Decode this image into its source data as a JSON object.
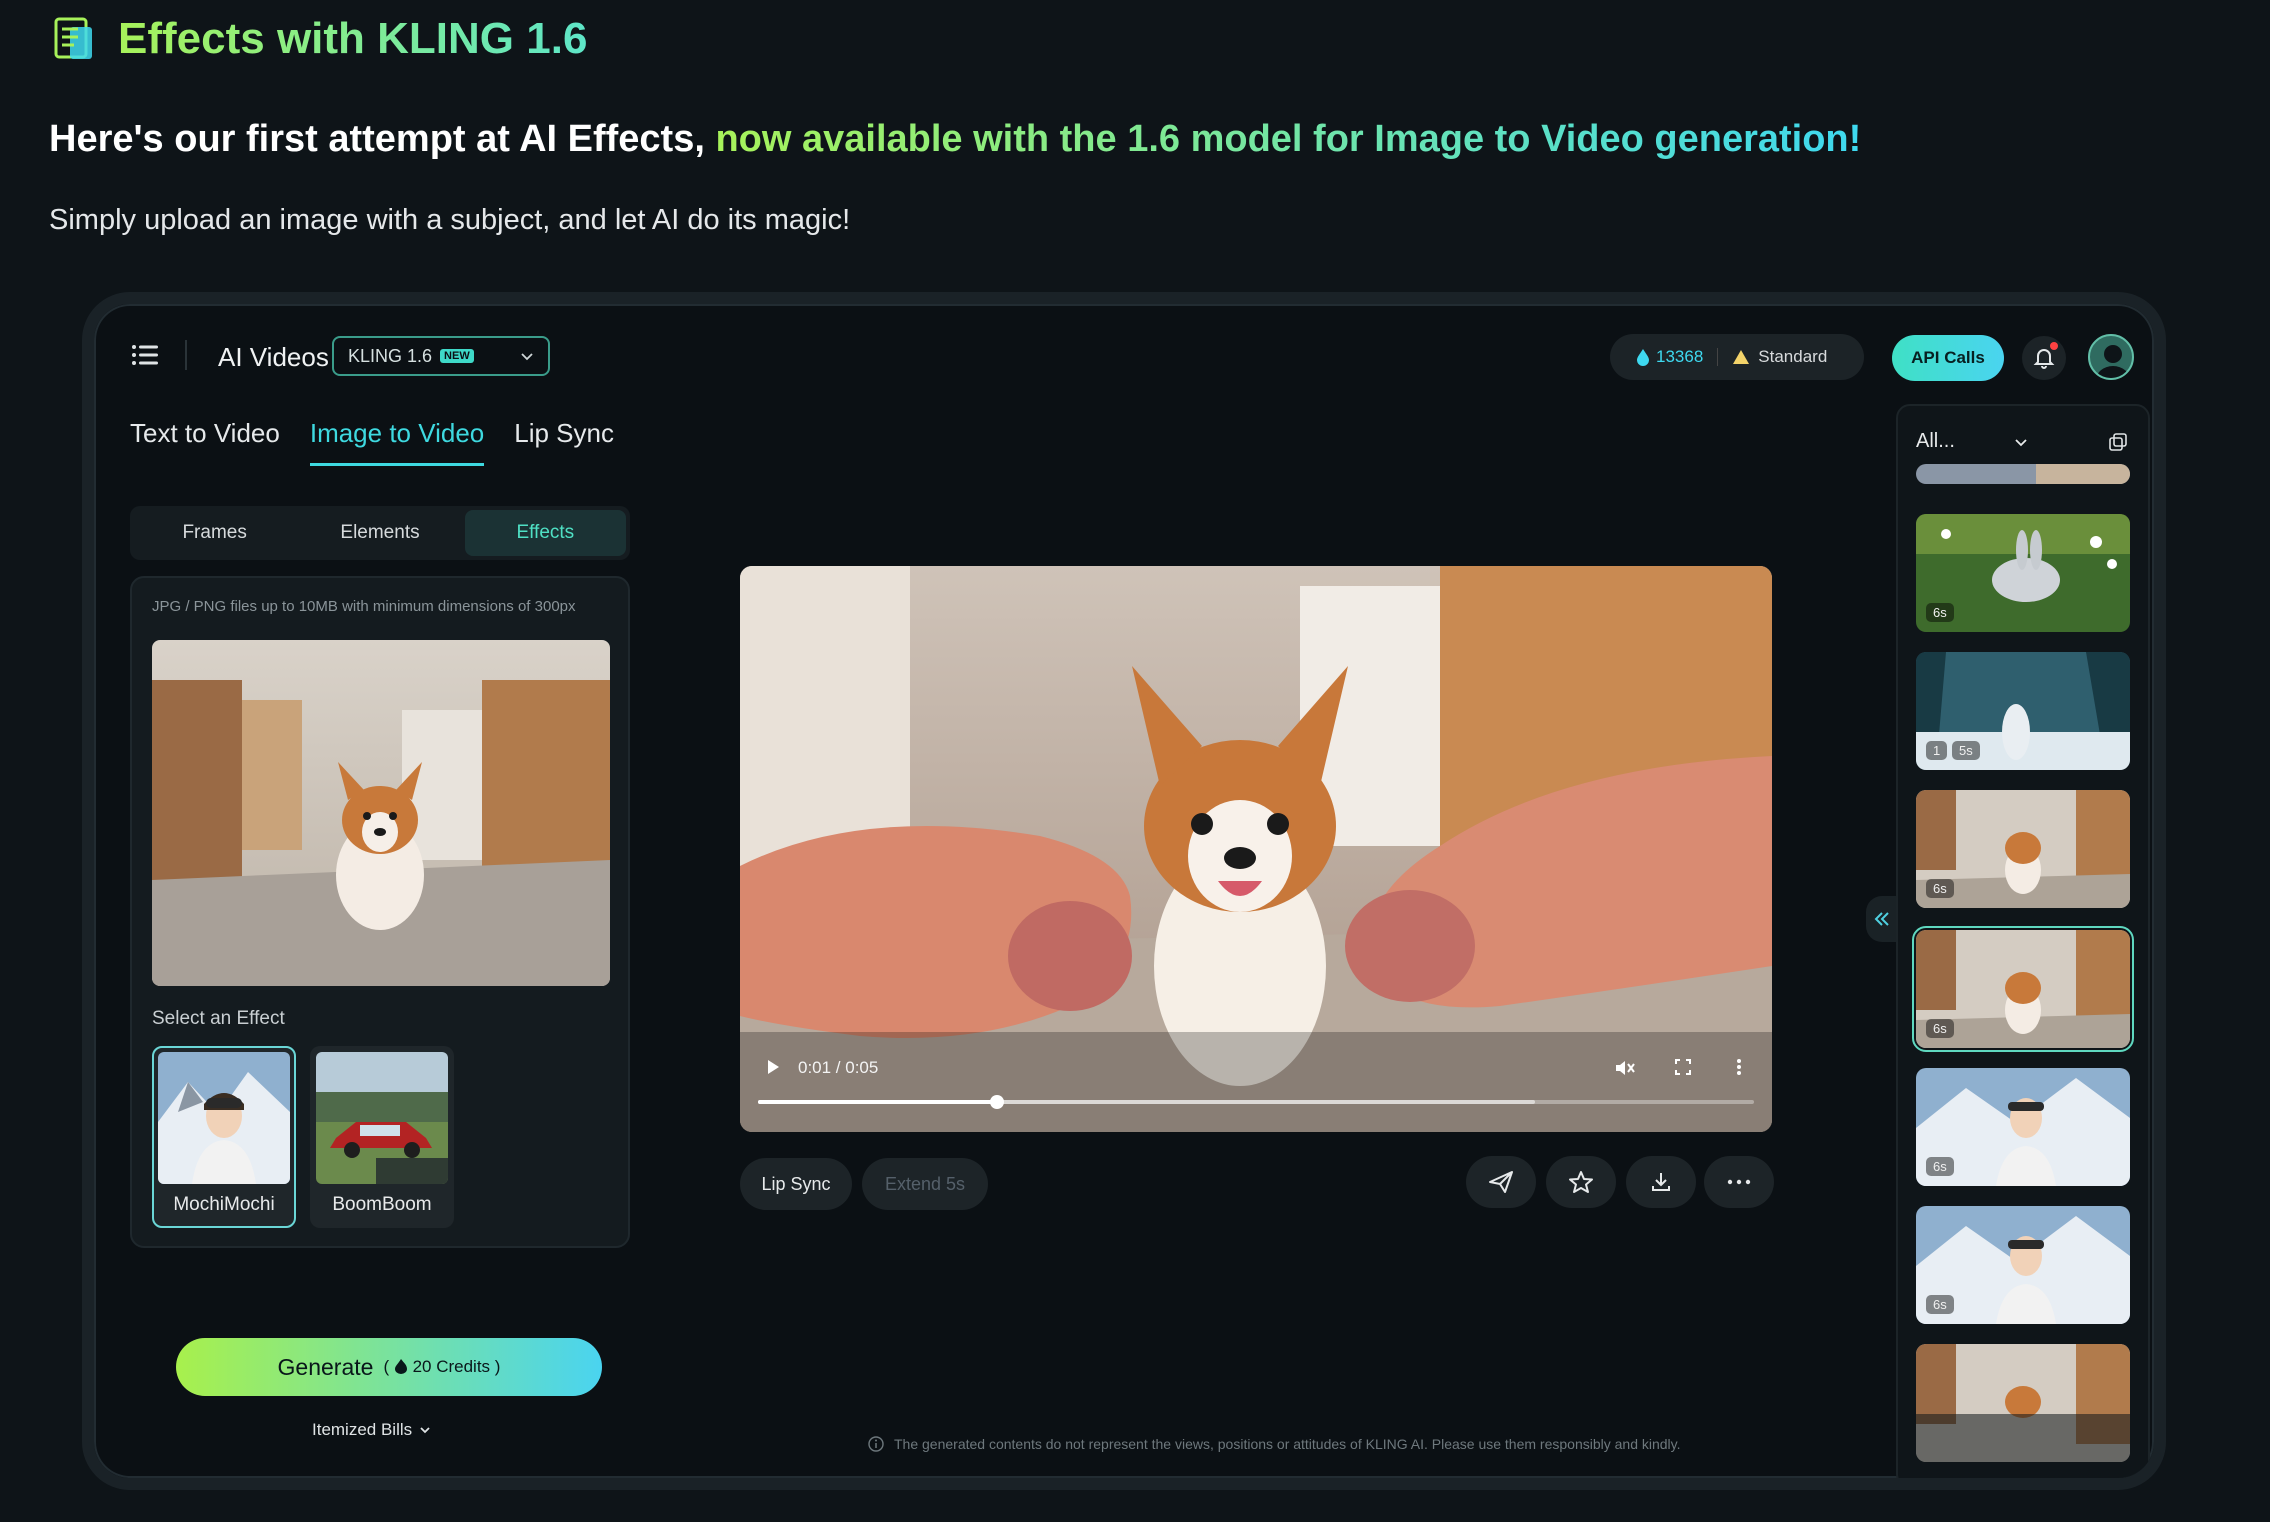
{
  "page": {
    "title": "Effects with KLING 1.6",
    "headline_plain": "Here's our first attempt at AI Effects, ",
    "headline_highlight": "now available with the 1.6 model for Image to Video generation!",
    "subline": "Simply upload an image with a subject, and let AI do its magic!"
  },
  "header": {
    "app_title": "AI Videos",
    "model": "KLING 1.6",
    "new_badge": "NEW",
    "credits": "13368",
    "plan": "Standard",
    "api_label": "API Calls"
  },
  "tabs": [
    "Text to Video",
    "Image to Video",
    "Lip Sync"
  ],
  "segments": [
    "Frames",
    "Elements",
    "Effects"
  ],
  "upload": {
    "hint": "JPG / PNG files up to 10MB with minimum dimensions of 300px",
    "select_label": "Select an Effect",
    "effects": [
      "MochiMochi",
      "BoomBoom"
    ]
  },
  "generate": {
    "label": "Generate",
    "credits_text": "20 Credits",
    "itemized": "Itemized Bills"
  },
  "video": {
    "time": "0:01 / 0:05",
    "progress": 0.24,
    "buffered": 0.78
  },
  "actions": {
    "lip_sync": "Lip Sync",
    "extend": "Extend 5s"
  },
  "disclaimer": "The generated contents do not represent the views, positions or attitudes of KLING AI. Please use them responsibly and kindly.",
  "history": {
    "filter": "All...",
    "items": [
      {
        "badge": "6s"
      },
      {
        "badge": "1",
        "badge2": "5s"
      },
      {
        "badge": "6s"
      },
      {
        "badge": "6s"
      },
      {
        "badge": "6s"
      },
      {
        "badge": "6s"
      },
      {
        "badge": ""
      }
    ]
  },
  "colors": {
    "accent": "#3ed9e0",
    "accent_green": "#a8f04c",
    "background": "#0e1418"
  }
}
